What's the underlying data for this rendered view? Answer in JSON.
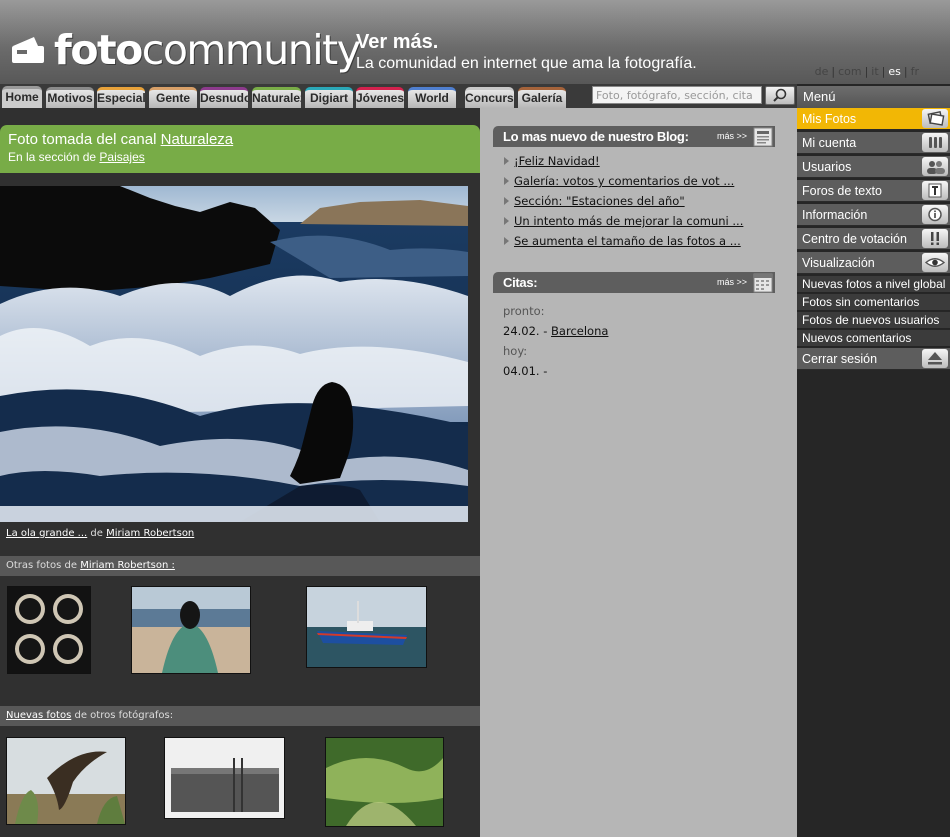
{
  "header": {
    "logo_bold": "foto",
    "logo_light": "community",
    "tagline_big": "Ver más.",
    "tagline_small": "La comunidad en internet que ama la fotografía.",
    "languages": [
      {
        "code": "de",
        "active": false
      },
      {
        "code": "com",
        "active": false
      },
      {
        "code": "it",
        "active": false
      },
      {
        "code": "es",
        "active": true
      },
      {
        "code": "fr",
        "active": false
      }
    ]
  },
  "tabs": [
    {
      "label": "Home",
      "color": "#9a9a9a",
      "active": true
    },
    {
      "label": "Motivos",
      "color": "#8a8a8a"
    },
    {
      "label": "Especial",
      "color": "#e8a23a"
    },
    {
      "label": "Gente",
      "color": "#d8a068"
    },
    {
      "label": "Desnudo",
      "color": "#8d3a8d"
    },
    {
      "label": "Naturaleza",
      "color": "#79ad47"
    },
    {
      "label": "Digiart",
      "color": "#2aa8b8"
    },
    {
      "label": "Jóvenes",
      "color": "#d3214d"
    },
    {
      "label": "World",
      "color": "#4f7fd0"
    },
    {
      "label": "Concursos",
      "color": "#c9c9c9"
    },
    {
      "label": "Galería",
      "color": "#a5633a"
    }
  ],
  "search": {
    "placeholder": "Foto, fotógrafo, sección, cita"
  },
  "channel": {
    "prefix": "Foto tomada del canal",
    "channel_name": "Naturaleza",
    "section_prefix": "En la sección de",
    "section_name": "Paisajes"
  },
  "photo": {
    "title": "La ola grande ...",
    "by": "de",
    "author": "Miriam Robertson"
  },
  "other_photos": {
    "prefix": "Otras fotos de",
    "author": "Miriam Robertson :"
  },
  "new_photos": {
    "link": "Nuevas fotos",
    "suffix": "de otros fotógrafos:"
  },
  "blog": {
    "title": "Lo mas nuevo de nuestro Blog:",
    "more": "más >>",
    "items": [
      "¡Feliz Navidad!",
      "Galería: votos y comentarios de vot ...",
      "Sección: \"Estaciones del año\"",
      "Un intento más de mejorar la comuni ...",
      "Se aumenta el tamaño de las fotos a ..."
    ]
  },
  "citas": {
    "title": "Citas:",
    "more": "más >>",
    "soon_label": "pronto:",
    "soon_date": "24.02. -",
    "soon_place": "Barcelona",
    "today_label": "hoy:",
    "today_date": "04.01. -"
  },
  "menu": {
    "title": "Menú",
    "items": [
      {
        "label": "Mis Fotos",
        "icon": "photos-icon",
        "active": true
      },
      {
        "label": "Mi cuenta",
        "icon": "abacus-icon"
      },
      {
        "label": "Usuarios",
        "icon": "users-icon"
      },
      {
        "label": "Foros de texto",
        "icon": "text-icon"
      },
      {
        "label": "Información",
        "icon": "info-icon"
      },
      {
        "label": "Centro de votación",
        "icon": "exclamation-icon"
      },
      {
        "label": "Visualización",
        "icon": "eye-icon"
      }
    ],
    "subitems": [
      "Nuevas fotos a nivel global",
      "Fotos sin comentarios",
      "Fotos de nuevos usuarios",
      "Nuevos comentarios"
    ],
    "logout": {
      "label": "Cerrar sesión",
      "icon": "eject-icon"
    }
  }
}
